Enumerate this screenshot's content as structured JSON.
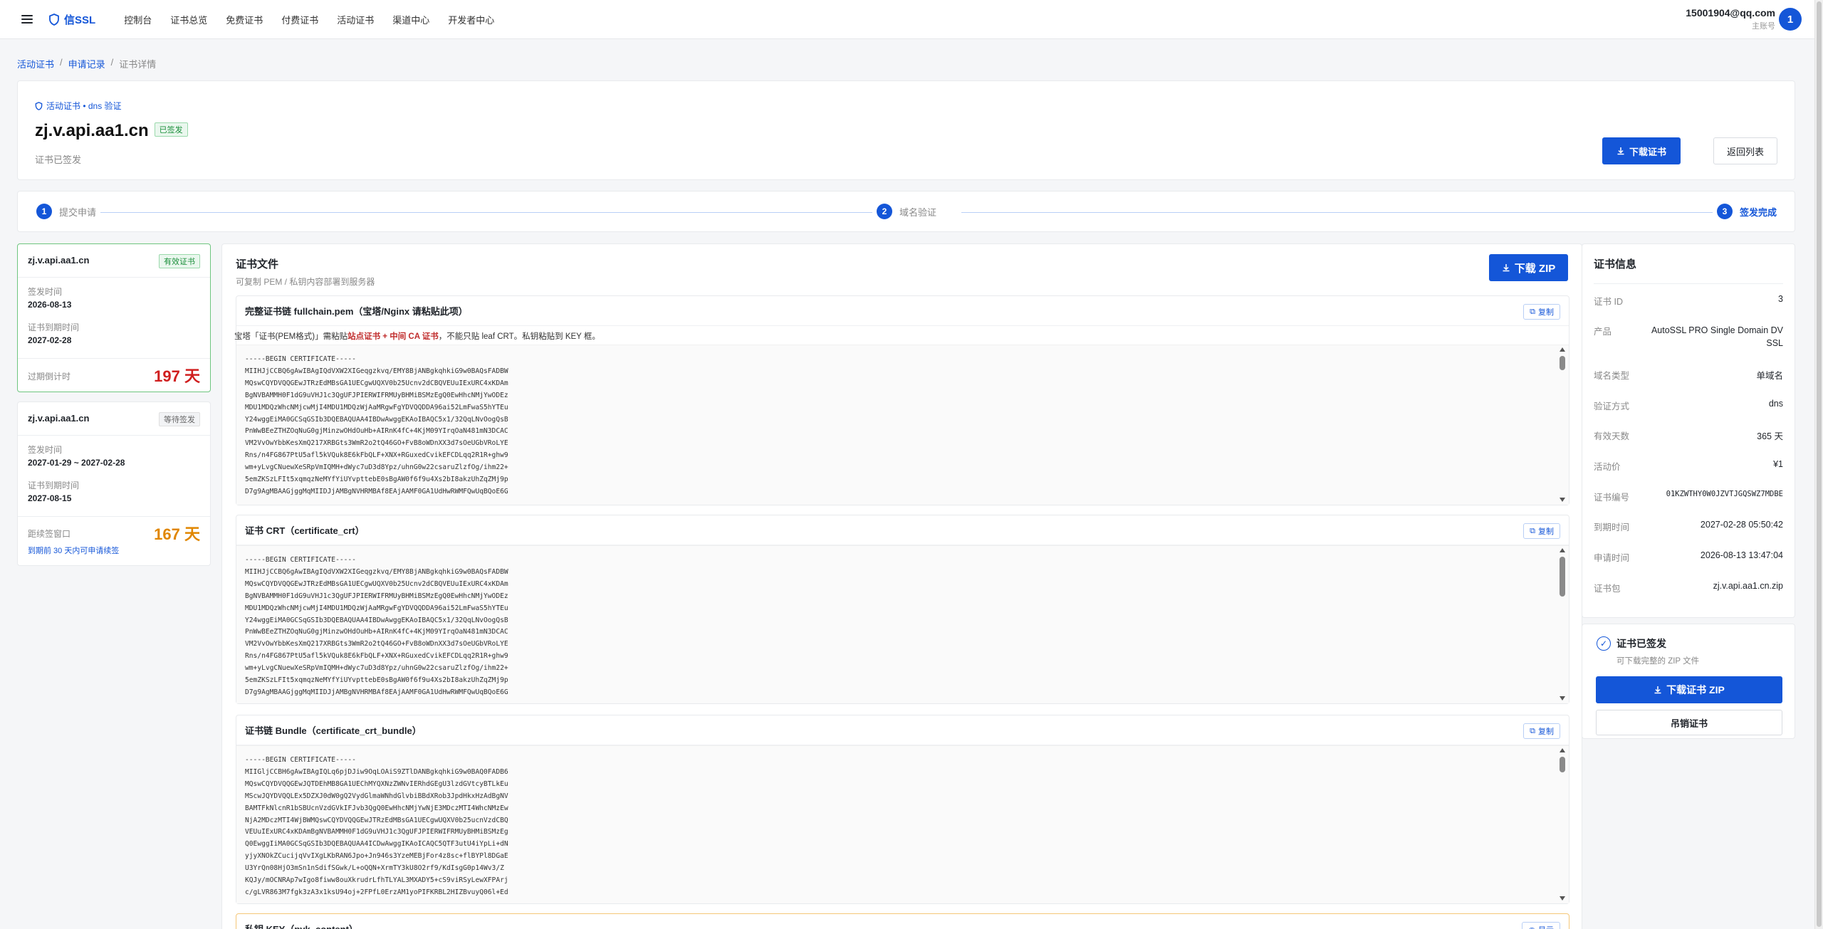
{
  "nav": {
    "logo": "信SSL",
    "items": [
      "控制台",
      "证书总览",
      "免费证书",
      "付费证书",
      "活动证书",
      "渠道中心",
      "开发者中心"
    ]
  },
  "user": {
    "email": "15001904@qq.com",
    "role": "主账号",
    "avatar": "1"
  },
  "breadcrumb": {
    "items": [
      "活动证书",
      "申请记录",
      "证书详情"
    ],
    "sep": "/"
  },
  "header": {
    "tagline": "活动证书 • dns 验证",
    "domain": "zj.v.api.aa1.cn",
    "badge": "已签发",
    "status": "证书已签发",
    "download": "下载证书",
    "back": "返回列表"
  },
  "steps": [
    {
      "num": "1",
      "label": "提交申请"
    },
    {
      "num": "2",
      "label": "域名验证"
    },
    {
      "num": "3",
      "label": "签发完成"
    }
  ],
  "certs": [
    {
      "name": "zj.v.api.aa1.cn",
      "tag": "有效证书",
      "k1": "签发时间",
      "v1": "2026-08-13",
      "k2": "证书到期时间",
      "v2": "2027-02-28",
      "k3": "过期倒计时",
      "big": "197 天"
    },
    {
      "name": "zj.v.api.aa1.cn",
      "tag": "等待签发",
      "k1": "签发时间",
      "v1": "2027-01-29 ~ 2027-02-28",
      "k2": "证书到期时间",
      "v2": "2027-08-15",
      "k3": "距续签窗口",
      "big": "167 天",
      "sub": "到期前 30 天内可申请续签"
    }
  ],
  "files": {
    "title": "证书文件",
    "subtitle": "可复制 PEM / 私钥内容部署到服务器",
    "zip": "下载 ZIP",
    "copy": "复制",
    "blocks": [
      {
        "title": "完整证书链 fullchain.pem（宝塔/Nginx 请粘贴此项）",
        "hint_a": "宝塔「证书(PEM格式)」需粘贴",
        "hint_b": "站点证书 + 中间 CA 证书",
        "hint_c": "，不能只贴 leaf CRT。私钥粘贴到 KEY 框。",
        "code": "-----BEGIN CERTIFICATE-----\nMIIHJjCCBQ6gAwIBAgIQdVXW2XIGeqgzkvq/EMY8BjANBgkqhkiG9w0BAQsFADBW\nMQswCQYDVQQGEwJTRzEdMBsGA1UECgwUQXV0b25Ucnv2dCBQVEUuIExURC4xKDAm\nBgNVBAMMH0F1dG9uVHJ1c3QgUFJPIERWIFRMUyBHMiBSMzEgQ0EwHhcNMjYwODEz\nMDU1MDQzWhcNMjcwMjI4MDU1MDQzWjAaMRgwFgYDVQQDDA96ai52LmFwaS5hYTEu\nY24wggEiMA0GCSqGSIb3DQEBAQUAA4IBDwAwggEKAoIBAQC5x1/32QqLNvOogQsB\nPnWwBEeZTHZOqNuG0gjMinzwOHdOuHb+AIRnK4fC+4KjM09YIrqOaN481mN3DCAC\nVM2VvOwYbbKesXmQ217XRBGts3WmR2o2tQ46GO+FvB8oWDnXX3d7sOeUGbVRoLYE\nRns/n4FG867PtU5afl5kVQuk8E6kFbQLF+XNX+RGuxedCvikEFCDLqq2R1R+ghw9\nwm+yLvgCNuewXeSRpVmIQMH+dWyc7uD3d8Ypz/uhnG0w22csaruZlzfOg/ihm22+\n5emZKSzLFIt5xqmqzNeMYfYiUYvpttebE0sBgAW0f6f9u4Xs2bI8akzUhZqZMj9p\nD7g9AgMBAAGjggMqMIIDJjAMBgNVHRMBAf8EAjAAMF0GA1UdHwRWMFQwUqBQoE6G"
      },
      {
        "title": "证书 CRT（certificate_crt）",
        "code": "-----BEGIN CERTIFICATE-----\nMIIHJjCCBQ6gAwIBAgIQdVXW2XIGeqgzkvq/EMY8BjANBgkqhkiG9w0BAQsFADBW\nMQswCQYDVQQGEwJTRzEdMBsGA1UECgwUQXV0b25Ucnv2dCBQVEUuIExURC4xKDAm\nBgNVBAMMH0F1dG9uVHJ1c3QgUFJPIERWIFRMUyBHMiBSMzEgQ0EwHhcNMjYwODEz\nMDU1MDQzWhcNMjcwMjI4MDU1MDQzWjAaMRgwFgYDVQQDDA96ai52LmFwaS5hYTEu\nY24wggEiMA0GCSqGSIb3DQEBAQUAA4IBDwAwggEKAoIBAQC5x1/32QqLNvOogQsB\nPnWwBEeZTHZOqNuG0gjMinzwOHdOuHb+AIRnK4fC+4KjM09YIrqOaN481mN3DCAC\nVM2VvOwYbbKesXmQ217XRBGts3WmR2o2tQ46GO+FvB8oWDnXX3d7sOeUGbVRoLYE\nRns/n4FG867PtU5afl5kVQuk8E6kFbQLF+XNX+RGuxedCvikEFCDLqq2R1R+ghw9\nwm+yLvgCNuewXeSRpVmIQMH+dWyc7uD3d8Ypz/uhnG0w22csaruZlzfOg/ihm22+\n5emZKSzLFIt5xqmqzNeMYfYiUYvpttebE0sBgAW0f6f9u4Xs2bI8akzUhZqZMj9p\nD7g9AgMBAAGjggMqMIIDJjAMBgNVHRMBAf8EAjAAMF0GA1UdHwRWMFQwUqBQoE6G"
      },
      {
        "title": "证书链 Bundle（certificate_crt_bundle）",
        "code": "-----BEGIN CERTIFICATE-----\nMIIGljCCBH6gAwIBAgIQLq6pjDJiw9OqLOAiS9ZTlDANBgkqhkiG9w0BAQ0FADB6\nMQswCQYDVQQGEwJQTDEhMB8GA1UEChMYQXNzZWNvIERhdGEgU3lzdGVtcyBTLkEu\nMScwJQYDVQQLEx5DZXJ0dW0gQ2VydGlmaWNhdGlvbiBBdXRob3JpdHkxHzAdBgNV\nBAMTFkNlcnR1bSBUcnVzdGVkIFJvb3QgQ0EwHhcNMjYwNjE3MDczMTI4WhcNMzEw\nNjA2MDczMTI4WjBWMQswCQYDVQQGEwJTRzEdMBsGA1UECgwUQXV0b25ucnVzdCBQ\nVEUuIExURC4xKDAmBgNVBAMMH0F1dG9uVHJ1c3QgUFJPIERWIFRMUyBHMiBSMzEg\nQ0EwggIiMA0GCSqGSIb3DQEBAQUAA4ICDwAwggIKAoICAQC5QTF3utU4iYpLi+dN\nyjyXNOkZCucijqVvIXgLKbRAN6Jpo+Jn946s3YzeMEBjFor4z8sc+flBYPl8DGaE\nU3YrQn08HjO3mSn1nSdifSGwk/L+oQQN+XrmTY3kU8O2rf9/KdIsgG0p14Wv3/Z\nKQJy/mOCNRAp7wIgo8fiww8ouXkrudrLfhTLYAL3MXADY5+cS9viRSyLewXFPArj\nc/gLVR863M7fgk3zA3x1ksU94oj+2FPfL0ErzAM1yoPIFKRBL2HIZBvuyQ06l+Ed"
      },
      {
        "title": "私钥 KEY（pvk_content）",
        "copy": "显示"
      }
    ]
  },
  "info": {
    "title": "证书信息",
    "rows": [
      {
        "k": "证书 ID",
        "v": "3"
      },
      {
        "k": "产品",
        "v": "AutoSSL PRO Single Domain DV SSL"
      },
      {
        "k": "域名类型",
        "v": "单域名"
      },
      {
        "k": "验证方式",
        "v": "dns"
      },
      {
        "k": "有效天数",
        "v": "365 天"
      },
      {
        "k": "活动价",
        "v": "¥1"
      },
      {
        "k": "证书编号",
        "v": "01KZWTHY0W0JZVTJGQSWZ7MDBE"
      },
      {
        "k": "到期时间",
        "v": "2027-02-28 05:50:42"
      },
      {
        "k": "申请时间",
        "v": "2026-08-13 13:47:04"
      },
      {
        "k": "证书包",
        "v": "zj.v.api.aa1.cn.zip"
      }
    ]
  },
  "done": {
    "title": "证书已签发",
    "subtitle": "可下载完整的 ZIP 文件",
    "download": "下载证书 ZIP",
    "revoke": "吊销证书"
  },
  "colors": {
    "primary": "#1456d8",
    "success": "#1a8f3a",
    "danger": "#d01f1f",
    "warning": "#e08600"
  },
  "icons": [
    "menu-icon",
    "shield-icon",
    "download-icon",
    "copy-icon",
    "check-circle-icon"
  ]
}
